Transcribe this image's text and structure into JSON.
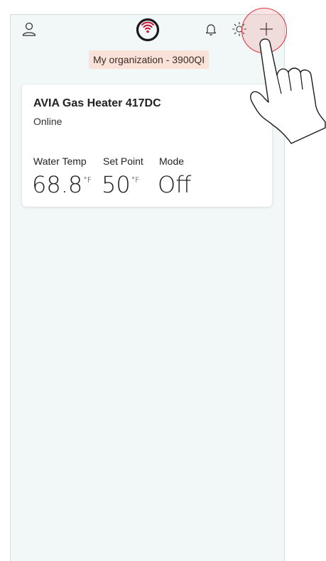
{
  "topbar": {
    "profile_icon": "user-icon",
    "logo_icon": "wifi-logo-icon",
    "notifications_icon": "bell-icon",
    "theme_icon": "sun-icon",
    "add_icon": "plus-icon"
  },
  "organization": {
    "label": "My organization - 3900QI"
  },
  "device": {
    "name": "AVIA Gas Heater 417DC",
    "status": "Online",
    "status_color": "#3cb043",
    "metrics": [
      {
        "label": "Water Temp",
        "value": "68.8",
        "unit": "°F"
      },
      {
        "label": "Set Point",
        "value": "50",
        "unit": "°F"
      },
      {
        "label": "Mode",
        "value": "Off",
        "unit": ""
      }
    ]
  },
  "colors": {
    "brand_accent": "#c8102e",
    "background": "#f2f7f7",
    "badge_bg": "#fbe2d8",
    "touch_highlight": "#e0303a"
  }
}
